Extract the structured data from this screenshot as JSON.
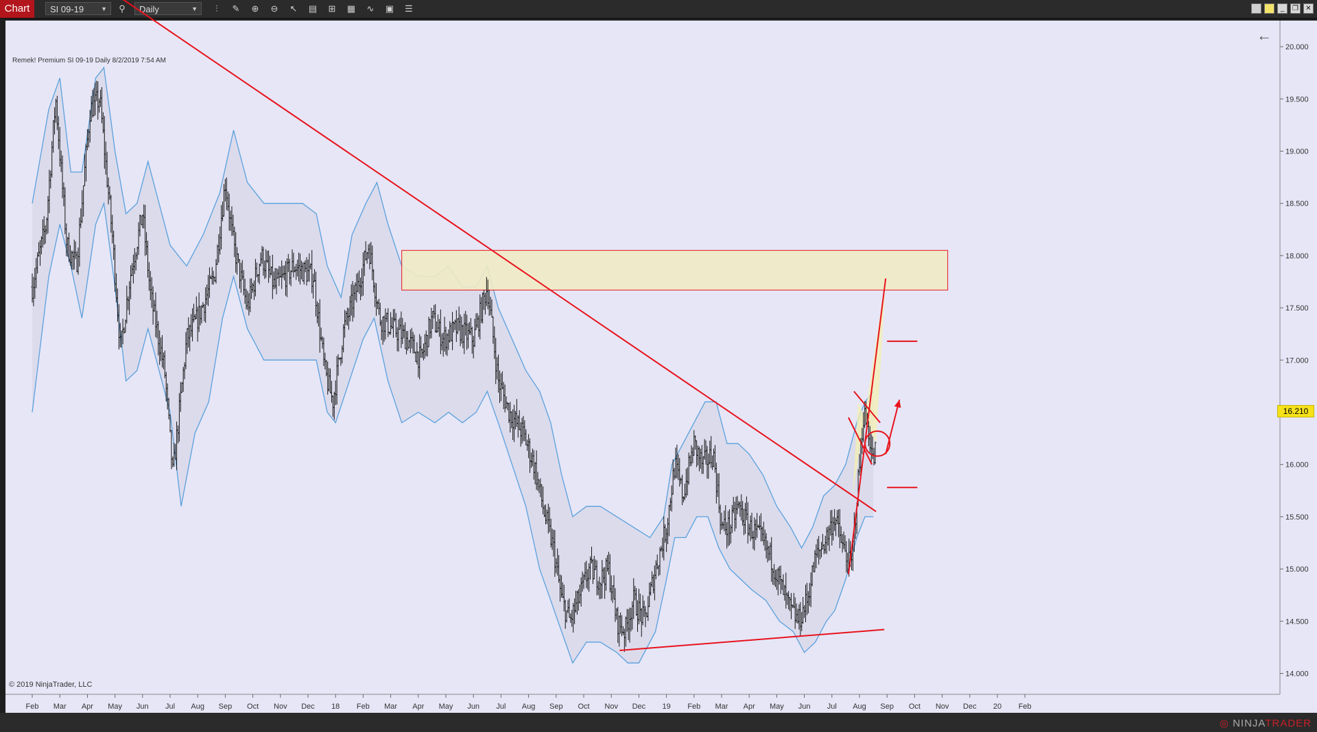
{
  "toolbar": {
    "tab_label": "Chart",
    "instrument": "SI 09-19",
    "period": "Daily"
  },
  "header": {
    "info_line": "Remek!  Premium  SI 09-19  Daily  8/2/2019 7:54 AM",
    "copyright": "© 2019 NinjaTrader, LLC",
    "brand_prefix": "NINJA",
    "brand_suffix": "TRADER"
  },
  "colors": {
    "plot_bg": "#e6e6f7",
    "trendline": "#e8121b",
    "zone_fill": "#efeac4",
    "band": "#5aa0dc",
    "price_tag": "#f5e21a",
    "tab": "#b3151c"
  },
  "icons": [
    "search-icon",
    "bar-style-icon",
    "pencil-icon",
    "zoom-in-icon",
    "zoom-out-icon",
    "cursor-icon",
    "data-box-icon",
    "template-icon",
    "indicators-icon",
    "strategies-icon",
    "properties-icon",
    "list-icon",
    "back-arrow-icon"
  ],
  "chart_data": {
    "type": "candlestick",
    "instrument": "SI 09-19",
    "interval": "Daily",
    "last_price": "16.210",
    "ylim": [
      13.8,
      20.25
    ],
    "y_ticks": [
      20.0,
      19.5,
      19.0,
      18.5,
      18.0,
      17.5,
      17.0,
      16.5,
      16.0,
      15.5,
      15.0,
      14.5,
      14.0
    ],
    "y_tick_labels": [
      "20.000",
      "19.500",
      "19.000",
      "18.500",
      "18.000",
      "17.500",
      "17.000",
      "16.500",
      "16.000",
      "15.500",
      "15.000",
      "14.500",
      "14.000"
    ],
    "x_tick_labels": [
      "Feb",
      "Mar",
      "Apr",
      "May",
      "Jun",
      "Jul",
      "Aug",
      "Sep",
      "Oct",
      "Nov",
      "Dec",
      "18",
      "Feb",
      "Mar",
      "Apr",
      "May",
      "Jun",
      "Jul",
      "Aug",
      "Sep",
      "Oct",
      "Nov",
      "Dec",
      "19",
      "Feb",
      "Mar",
      "Apr",
      "May",
      "Jun",
      "Jul",
      "Aug",
      "Sep",
      "Oct",
      "Nov",
      "Dec",
      "20",
      "Feb"
    ],
    "x_tick_index": [
      0,
      1,
      2,
      3,
      4,
      5,
      6,
      7,
      8,
      9,
      10,
      11,
      12,
      13,
      14,
      15,
      16,
      17,
      18,
      19,
      20,
      21,
      22,
      23,
      24,
      25,
      26,
      27,
      28,
      29,
      30,
      31,
      32,
      33,
      34,
      35,
      36
    ],
    "price_path": [
      [
        0.0,
        17.7
      ],
      [
        0.5,
        18.3
      ],
      [
        0.85,
        19.5
      ],
      [
        1.25,
        18.1
      ],
      [
        1.6,
        17.9
      ],
      [
        2.1,
        19.4
      ],
      [
        2.45,
        19.5
      ],
      [
        2.9,
        18.2
      ],
      [
        3.2,
        17.1
      ],
      [
        3.55,
        17.8
      ],
      [
        4.0,
        18.4
      ],
      [
        4.3,
        17.6
      ],
      [
        4.8,
        16.9
      ],
      [
        5.1,
        15.9
      ],
      [
        5.6,
        17.2
      ],
      [
        6.0,
        17.4
      ],
      [
        6.6,
        17.8
      ],
      [
        7.0,
        18.7
      ],
      [
        7.3,
        18.1
      ],
      [
        7.8,
        17.5
      ],
      [
        8.3,
        18.0
      ],
      [
        8.8,
        17.7
      ],
      [
        9.5,
        17.9
      ],
      [
        10.2,
        17.8
      ],
      [
        10.6,
        16.9
      ],
      [
        10.9,
        16.6
      ],
      [
        11.3,
        17.3
      ],
      [
        11.8,
        17.7
      ],
      [
        12.2,
        18.1
      ],
      [
        12.6,
        17.4
      ],
      [
        13.1,
        17.3
      ],
      [
        13.6,
        17.2
      ],
      [
        14.1,
        17.0
      ],
      [
        14.5,
        17.4
      ],
      [
        14.9,
        17.2
      ],
      [
        15.4,
        17.3
      ],
      [
        16.0,
        17.2
      ],
      [
        16.5,
        17.7
      ],
      [
        16.9,
        16.8
      ],
      [
        17.3,
        16.5
      ],
      [
        17.8,
        16.3
      ],
      [
        18.2,
        16.0
      ],
      [
        18.6,
        15.5
      ],
      [
        18.9,
        15.2
      ],
      [
        19.2,
        14.7
      ],
      [
        19.5,
        14.5
      ],
      [
        19.8,
        14.7
      ],
      [
        20.2,
        15.0
      ],
      [
        20.6,
        14.9
      ],
      [
        20.9,
        15.0
      ],
      [
        21.2,
        14.5
      ],
      [
        21.5,
        14.4
      ],
      [
        21.8,
        14.7
      ],
      [
        22.2,
        14.5
      ],
      [
        22.6,
        15.0
      ],
      [
        23.0,
        15.4
      ],
      [
        23.3,
        16.0
      ],
      [
        23.6,
        15.7
      ],
      [
        24.0,
        16.2
      ],
      [
        24.3,
        16.0
      ],
      [
        24.7,
        16.1
      ],
      [
        25.0,
        15.4
      ],
      [
        25.3,
        15.4
      ],
      [
        25.6,
        15.6
      ],
      [
        26.0,
        15.4
      ],
      [
        26.4,
        15.3
      ],
      [
        26.8,
        15.1
      ],
      [
        27.2,
        14.8
      ],
      [
        27.5,
        14.6
      ],
      [
        27.8,
        14.5
      ],
      [
        28.1,
        14.7
      ],
      [
        28.4,
        15.1
      ],
      [
        28.8,
        15.3
      ],
      [
        29.1,
        15.5
      ],
      [
        29.4,
        15.2
      ],
      [
        29.7,
        15.0
      ],
      [
        30.0,
        16.0
      ],
      [
        30.15,
        16.5
      ],
      [
        30.35,
        16.3
      ],
      [
        30.5,
        16.0
      ],
      [
        30.6,
        16.21
      ]
    ],
    "band_upper": [
      [
        0.0,
        18.5
      ],
      [
        0.6,
        19.4
      ],
      [
        1.0,
        19.7
      ],
      [
        1.4,
        18.8
      ],
      [
        1.8,
        18.8
      ],
      [
        2.3,
        19.7
      ],
      [
        2.6,
        19.8
      ],
      [
        3.0,
        19.0
      ],
      [
        3.4,
        18.4
      ],
      [
        3.8,
        18.5
      ],
      [
        4.2,
        18.9
      ],
      [
        4.6,
        18.5
      ],
      [
        5.0,
        18.1
      ],
      [
        5.6,
        17.9
      ],
      [
        6.2,
        18.2
      ],
      [
        6.8,
        18.6
      ],
      [
        7.3,
        19.2
      ],
      [
        7.8,
        18.7
      ],
      [
        8.4,
        18.5
      ],
      [
        9.0,
        18.5
      ],
      [
        9.8,
        18.5
      ],
      [
        10.3,
        18.4
      ],
      [
        10.7,
        17.9
      ],
      [
        11.2,
        17.6
      ],
      [
        11.6,
        18.2
      ],
      [
        12.1,
        18.5
      ],
      [
        12.5,
        18.7
      ],
      [
        12.9,
        18.3
      ],
      [
        13.4,
        17.9
      ],
      [
        14.0,
        17.8
      ],
      [
        14.6,
        17.8
      ],
      [
        15.1,
        17.9
      ],
      [
        15.6,
        17.7
      ],
      [
        16.1,
        17.7
      ],
      [
        16.5,
        17.9
      ],
      [
        16.9,
        17.5
      ],
      [
        17.4,
        17.2
      ],
      [
        17.9,
        16.9
      ],
      [
        18.4,
        16.7
      ],
      [
        18.8,
        16.4
      ],
      [
        19.2,
        15.9
      ],
      [
        19.6,
        15.5
      ],
      [
        20.1,
        15.6
      ],
      [
        20.6,
        15.6
      ],
      [
        21.2,
        15.5
      ],
      [
        21.8,
        15.4
      ],
      [
        22.4,
        15.3
      ],
      [
        22.9,
        15.5
      ],
      [
        23.2,
        16.0
      ],
      [
        23.6,
        16.2
      ],
      [
        24.0,
        16.4
      ],
      [
        24.4,
        16.6
      ],
      [
        24.8,
        16.6
      ],
      [
        25.2,
        16.2
      ],
      [
        25.6,
        16.2
      ],
      [
        26.0,
        16.1
      ],
      [
        26.5,
        15.9
      ],
      [
        27.0,
        15.6
      ],
      [
        27.5,
        15.4
      ],
      [
        27.9,
        15.2
      ],
      [
        28.3,
        15.4
      ],
      [
        28.7,
        15.7
      ],
      [
        29.1,
        15.8
      ],
      [
        29.5,
        16.0
      ],
      [
        29.9,
        16.4
      ],
      [
        30.2,
        16.6
      ],
      [
        30.5,
        16.7
      ]
    ],
    "band_lower": [
      [
        0.0,
        16.5
      ],
      [
        0.6,
        17.8
      ],
      [
        1.0,
        18.3
      ],
      [
        1.4,
        17.9
      ],
      [
        1.8,
        17.4
      ],
      [
        2.3,
        18.3
      ],
      [
        2.6,
        18.5
      ],
      [
        3.0,
        17.7
      ],
      [
        3.4,
        16.8
      ],
      [
        3.8,
        16.9
      ],
      [
        4.2,
        17.3
      ],
      [
        4.6,
        16.9
      ],
      [
        5.0,
        16.5
      ],
      [
        5.4,
        15.6
      ],
      [
        5.9,
        16.3
      ],
      [
        6.4,
        16.6
      ],
      [
        6.9,
        17.4
      ],
      [
        7.3,
        17.8
      ],
      [
        7.8,
        17.3
      ],
      [
        8.4,
        17.0
      ],
      [
        9.0,
        17.0
      ],
      [
        9.8,
        17.0
      ],
      [
        10.3,
        17.0
      ],
      [
        10.7,
        16.5
      ],
      [
        11.0,
        16.4
      ],
      [
        11.5,
        16.8
      ],
      [
        12.0,
        17.2
      ],
      [
        12.4,
        17.4
      ],
      [
        12.9,
        16.8
      ],
      [
        13.4,
        16.4
      ],
      [
        14.0,
        16.5
      ],
      [
        14.6,
        16.4
      ],
      [
        15.1,
        16.5
      ],
      [
        15.6,
        16.4
      ],
      [
        16.1,
        16.5
      ],
      [
        16.5,
        16.7
      ],
      [
        16.9,
        16.4
      ],
      [
        17.4,
        16.0
      ],
      [
        17.9,
        15.6
      ],
      [
        18.4,
        15.0
      ],
      [
        18.8,
        14.7
      ],
      [
        19.2,
        14.4
      ],
      [
        19.6,
        14.1
      ],
      [
        20.1,
        14.3
      ],
      [
        20.6,
        14.3
      ],
      [
        21.2,
        14.2
      ],
      [
        21.6,
        14.1
      ],
      [
        22.0,
        14.1
      ],
      [
        22.6,
        14.4
      ],
      [
        23.0,
        14.9
      ],
      [
        23.3,
        15.3
      ],
      [
        23.7,
        15.3
      ],
      [
        24.1,
        15.5
      ],
      [
        24.5,
        15.5
      ],
      [
        24.9,
        15.2
      ],
      [
        25.3,
        15.0
      ],
      [
        25.7,
        14.9
      ],
      [
        26.1,
        14.8
      ],
      [
        26.6,
        14.7
      ],
      [
        27.1,
        14.5
      ],
      [
        27.6,
        14.4
      ],
      [
        28.0,
        14.2
      ],
      [
        28.4,
        14.3
      ],
      [
        28.8,
        14.5
      ],
      [
        29.1,
        14.6
      ],
      [
        29.5,
        14.9
      ],
      [
        29.9,
        15.3
      ],
      [
        30.2,
        15.5
      ],
      [
        30.5,
        15.5
      ]
    ],
    "trendlines": [
      {
        "name": "descending-resistance",
        "from": [
          2.75,
          20.55
        ],
        "to": [
          30.6,
          15.55
        ]
      },
      {
        "name": "rising-support",
        "from": [
          21.3,
          14.22
        ],
        "to": [
          30.9,
          14.42
        ]
      },
      {
        "name": "breakout-leg",
        "from": [
          29.6,
          14.95
        ],
        "to": [
          30.95,
          17.78
        ]
      },
      {
        "name": "flag-top",
        "from": [
          29.8,
          16.7
        ],
        "to": [
          30.75,
          16.4
        ]
      },
      {
        "name": "flag-bottom",
        "from": [
          29.6,
          16.45
        ],
        "to": [
          30.45,
          16.0
        ]
      },
      {
        "name": "target-upper",
        "from": [
          31.0,
          17.18
        ],
        "to": [
          32.1,
          17.18
        ]
      },
      {
        "name": "target-lower",
        "from": [
          31.0,
          15.78
        ],
        "to": [
          32.1,
          15.78
        ]
      }
    ],
    "projection_arrow": {
      "from": [
        30.95,
        16.1
      ],
      "to": [
        31.45,
        16.62
      ]
    },
    "highlight_circle": {
      "center": [
        30.65,
        16.2
      ],
      "rx": 0.45,
      "ry": 0.12
    },
    "resistance_zone": {
      "x_from": 13.4,
      "x_to": 33.2,
      "y_from": 17.67,
      "y_to": 18.05
    }
  }
}
